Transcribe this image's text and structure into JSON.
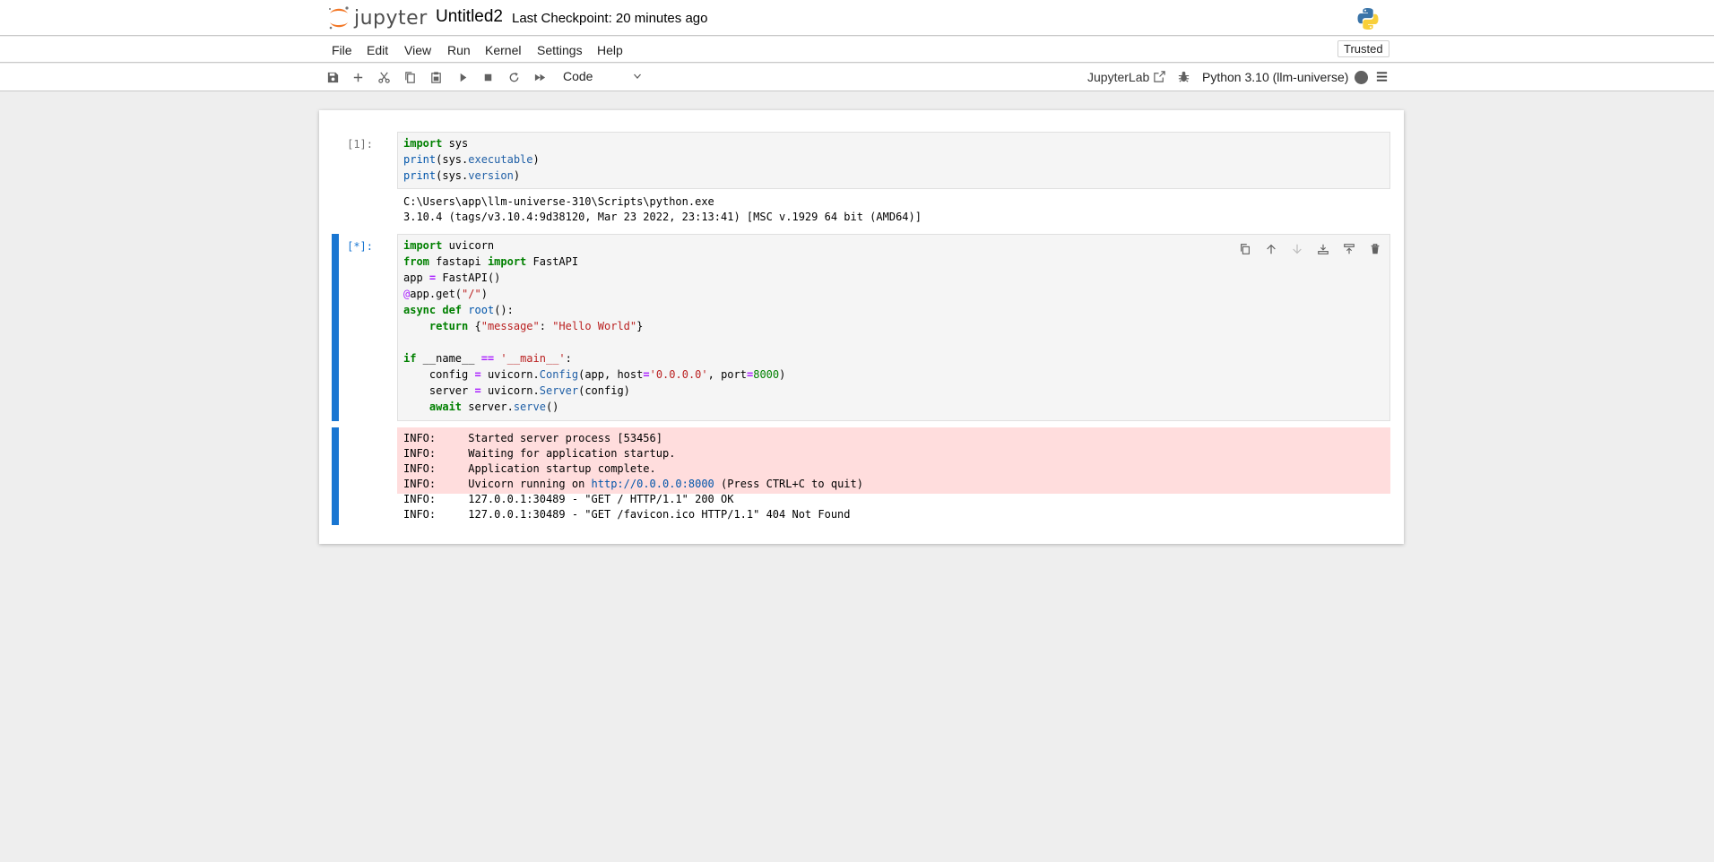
{
  "header": {
    "logo_text": "jupyter",
    "notebook_title": "Untitled2",
    "checkpoint": "Last Checkpoint: 20 minutes ago"
  },
  "menu": {
    "items": [
      "File",
      "Edit",
      "View",
      "Run",
      "Kernel",
      "Settings",
      "Help"
    ],
    "trusted": "Trusted"
  },
  "toolbar": {
    "buttons": [
      "save-icon",
      "add-cell-icon",
      "cut-icon",
      "copy-icon",
      "paste-icon",
      "run-icon",
      "stop-icon",
      "restart-icon",
      "fast-forward-icon"
    ],
    "cell_type": "Code",
    "jupyterlab_label": "JupyterLab",
    "kernel_name": "Python 3.10 (llm-universe)",
    "kernel_status_color": "#616161"
  },
  "cells": [
    {
      "prompt": "[1]:",
      "code": [
        "import sys",
        "print(sys.executable)",
        "print(sys.version)"
      ],
      "outputs": [
        "C:\\Users\\app\\llm-universe-310\\Scripts\\python.exe",
        "3.10.4 (tags/v3.10.4:9d38120, Mar 23 2022, 23:13:41) [MSC v.1929 64 bit (AMD64)]"
      ]
    },
    {
      "prompt": "[*]:",
      "code": [
        "import uvicorn",
        "from fastapi import FastAPI",
        "app = FastAPI()",
        "@app.get(\"/\")",
        "async def root():",
        "    return {\"message\": \"Hello World\"}",
        "",
        "if __name__ == '__main__':",
        "    config = uvicorn.Config(app, host='0.0.0.0', port=8000)",
        "    server = uvicorn.Server(config)",
        "    await server.serve()"
      ],
      "stderr": [
        "INFO:     Started server process [53456]",
        "INFO:     Waiting for application startup.",
        "INFO:     Application startup complete.",
        "INFO:     Uvicorn running on http://0.0.0.0:8000 (Press CTRL+C to quit)"
      ],
      "stdout": [
        "INFO:     127.0.0.1:30489 - \"GET / HTTP/1.1\" 200 OK",
        "INFO:     127.0.0.1:30489 - \"GET /favicon.ico HTTP/1.1\" 404 Not Found"
      ],
      "cell_tools": [
        "duplicate-icon",
        "move-up-icon",
        "move-down-icon",
        "insert-above-icon",
        "insert-below-icon",
        "delete-icon"
      ]
    }
  ],
  "colors": {
    "accent": "#1976d2",
    "stderr_bg": "#ffdddd",
    "jupyter_orange": "#f37726"
  }
}
